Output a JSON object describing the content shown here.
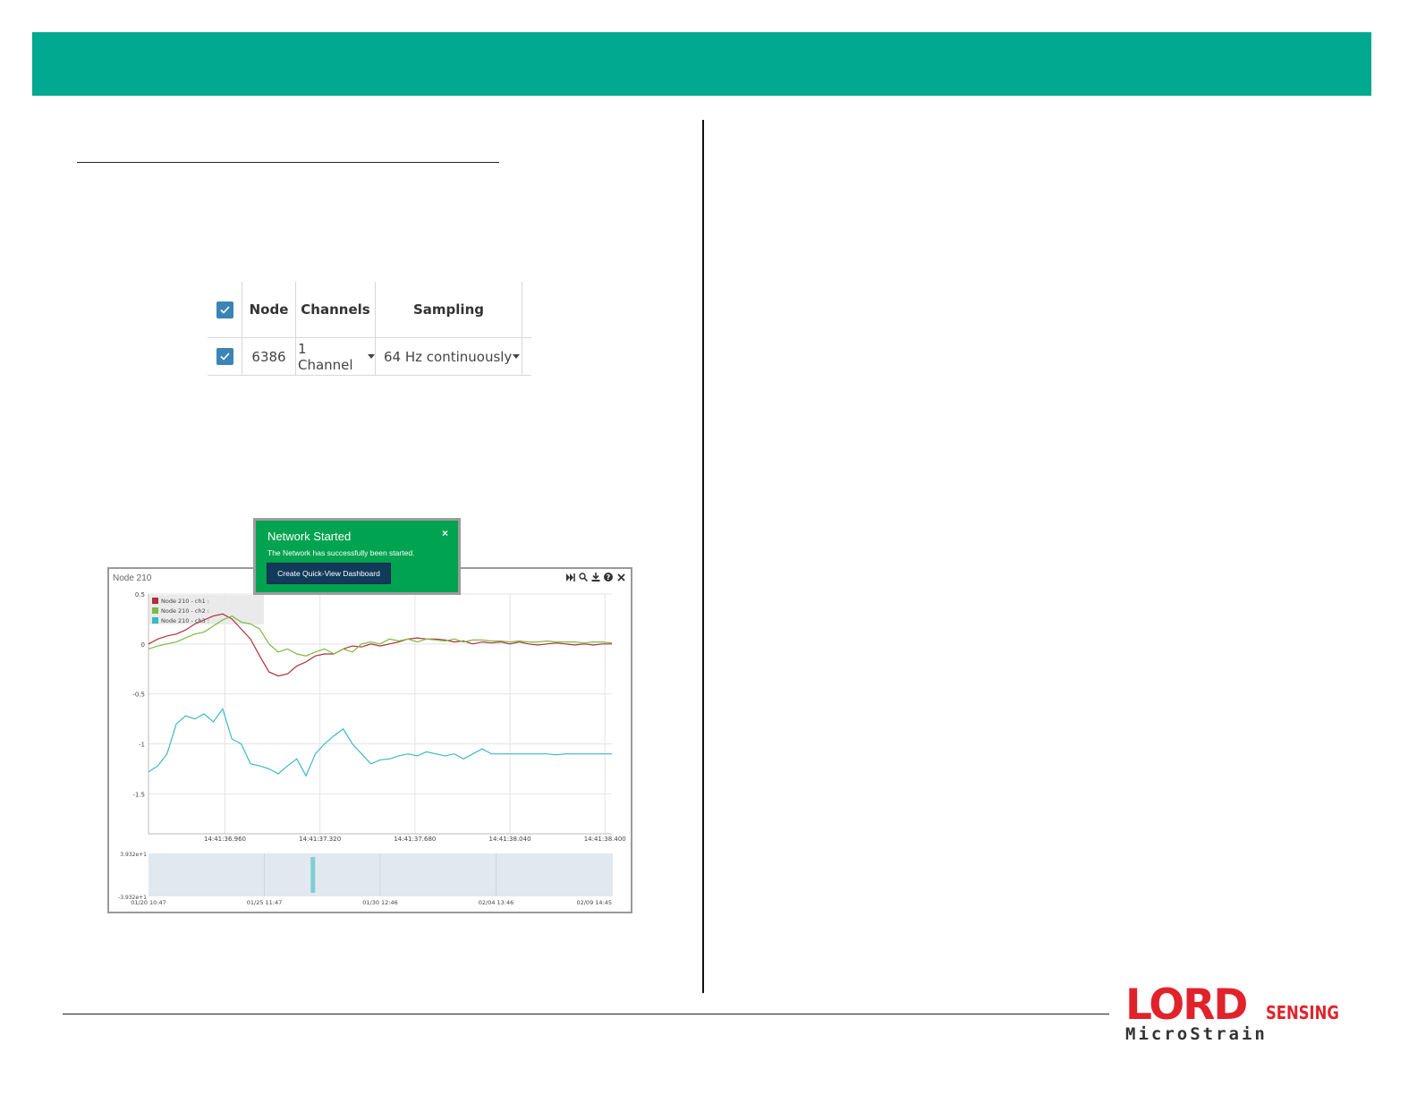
{
  "node_table": {
    "headers": [
      "Node",
      "Channels",
      "Sampling"
    ],
    "rows": [
      {
        "node": "6386",
        "channels": "1 Channel",
        "sampling": "64 Hz continuously"
      }
    ]
  },
  "notification": {
    "title": "Network Started",
    "message": "The Network has successfully been started.",
    "button_label": "Create Quick-View Dashboard",
    "close_glyph": "×"
  },
  "chart_panel": {
    "title": "Node 210",
    "toolbar_icons": [
      "skip-end-icon",
      "zoom-icon",
      "download-icon",
      "help-icon",
      "close-icon"
    ]
  },
  "chart_data": [
    {
      "type": "line",
      "legend": [
        "Node 210 - ch1 :",
        "Node 210 - ch2 :",
        "Node 210 - ch3 :"
      ],
      "ytick_labels": [
        "0.5",
        "0",
        "-0.5",
        "-1",
        "-1.5"
      ],
      "xtick_labels": [
        "14:41:36.960",
        "14:41:37.320",
        "14:41:37.680",
        "14:41:38.040",
        "14:41:38.400"
      ],
      "ylim": [
        -1.9,
        0.5
      ],
      "colors": [
        "#b0313a",
        "#7cbb3f",
        "#3bb9c4"
      ],
      "series": [
        {
          "name": "Node 210 - ch1 :",
          "x": [
            0,
            0.02,
            0.04,
            0.06,
            0.08,
            0.1,
            0.12,
            0.14,
            0.16,
            0.18,
            0.2,
            0.22,
            0.24,
            0.26,
            0.28,
            0.3,
            0.32,
            0.34,
            0.36,
            0.38,
            0.4,
            0.42,
            0.44,
            0.46,
            0.48,
            0.5,
            0.52,
            0.54,
            0.56,
            0.58,
            0.6,
            0.62,
            0.64,
            0.66,
            0.68,
            0.7,
            0.72,
            0.74,
            0.76,
            0.78,
            0.8,
            0.82,
            0.84,
            0.86,
            0.88,
            0.9,
            0.92,
            0.94,
            0.96,
            0.98,
            1
          ],
          "y": [
            0.0,
            0.05,
            0.08,
            0.1,
            0.14,
            0.2,
            0.24,
            0.28,
            0.3,
            0.25,
            0.15,
            0.05,
            -0.12,
            -0.28,
            -0.32,
            -0.3,
            -0.22,
            -0.18,
            -0.12,
            -0.1,
            -0.1,
            -0.05,
            -0.02,
            -0.03,
            0.0,
            -0.02,
            0.0,
            0.02,
            0.05,
            0.06,
            0.05,
            0.05,
            0.04,
            0.02,
            0.03,
            0.0,
            0.02,
            0.01,
            0.02,
            0.0,
            0.02,
            0.0,
            -0.01,
            0.0,
            0.01,
            0.0,
            -0.01,
            0.0,
            -0.01,
            0.0,
            0.0
          ]
        },
        {
          "name": "Node 210 - ch2 :",
          "x": [
            0,
            0.02,
            0.04,
            0.06,
            0.08,
            0.1,
            0.12,
            0.14,
            0.16,
            0.18,
            0.2,
            0.22,
            0.24,
            0.26,
            0.28,
            0.3,
            0.32,
            0.34,
            0.36,
            0.38,
            0.4,
            0.42,
            0.44,
            0.46,
            0.48,
            0.5,
            0.52,
            0.54,
            0.56,
            0.58,
            0.6,
            0.62,
            0.64,
            0.66,
            0.68,
            0.7,
            0.72,
            0.74,
            0.76,
            0.78,
            0.8,
            0.82,
            0.84,
            0.86,
            0.88,
            0.9,
            0.92,
            0.94,
            0.96,
            0.98,
            1
          ],
          "y": [
            -0.05,
            -0.02,
            0.0,
            0.02,
            0.06,
            0.1,
            0.12,
            0.18,
            0.24,
            0.28,
            0.22,
            0.2,
            0.15,
            0.0,
            -0.08,
            -0.05,
            -0.1,
            -0.12,
            -0.08,
            -0.05,
            -0.1,
            -0.05,
            -0.08,
            0.0,
            0.02,
            0.0,
            0.05,
            0.03,
            0.05,
            0.02,
            0.05,
            0.04,
            0.03,
            0.05,
            0.02,
            0.04,
            0.04,
            0.03,
            0.03,
            0.02,
            0.03,
            0.02,
            0.02,
            0.03,
            0.02,
            0.02,
            0.02,
            0.01,
            0.02,
            0.02,
            0.01
          ]
        },
        {
          "name": "Node 210 - ch3 :",
          "x": [
            0,
            0.02,
            0.04,
            0.06,
            0.08,
            0.1,
            0.12,
            0.14,
            0.16,
            0.18,
            0.2,
            0.22,
            0.24,
            0.26,
            0.28,
            0.3,
            0.32,
            0.34,
            0.36,
            0.38,
            0.4,
            0.42,
            0.44,
            0.46,
            0.48,
            0.5,
            0.52,
            0.54,
            0.56,
            0.58,
            0.6,
            0.62,
            0.64,
            0.66,
            0.68,
            0.7,
            0.72,
            0.74,
            0.76,
            0.78,
            0.8,
            0.82,
            0.84,
            0.86,
            0.88,
            0.9,
            0.92,
            0.94,
            0.96,
            0.98,
            1
          ],
          "y": [
            -1.28,
            -1.22,
            -1.1,
            -0.8,
            -0.72,
            -0.75,
            -0.7,
            -0.78,
            -0.65,
            -0.95,
            -1.0,
            -1.2,
            -1.22,
            -1.25,
            -1.3,
            -1.22,
            -1.15,
            -1.32,
            -1.1,
            -1.0,
            -0.92,
            -0.85,
            -1.0,
            -1.1,
            -1.2,
            -1.16,
            -1.15,
            -1.12,
            -1.1,
            -1.12,
            -1.08,
            -1.1,
            -1.12,
            -1.1,
            -1.15,
            -1.1,
            -1.05,
            -1.1,
            -1.1,
            -1.1,
            -1.1,
            -1.1,
            -1.1,
            -1.1,
            -1.11,
            -1.1,
            -1.1,
            -1.1,
            -1.1,
            -1.1,
            -1.1
          ]
        }
      ]
    },
    {
      "type": "area",
      "ytick_labels": [
        "3.932e+1",
        "-3.932e+1"
      ],
      "xtick_labels": [
        "01/20 10:47",
        "01/25 11:47",
        "01/30 12:46",
        "02/04 13:46",
        "02/09 14:45"
      ]
    }
  ],
  "logo": {
    "brand": "LORD",
    "sensing": "SENSING",
    "micro": "MicroStrain",
    "color": "#e0232b"
  },
  "colors": {
    "header_bar": "#00a98f",
    "toast_bg": "#00a34f",
    "button_bg": "#123a5a"
  }
}
